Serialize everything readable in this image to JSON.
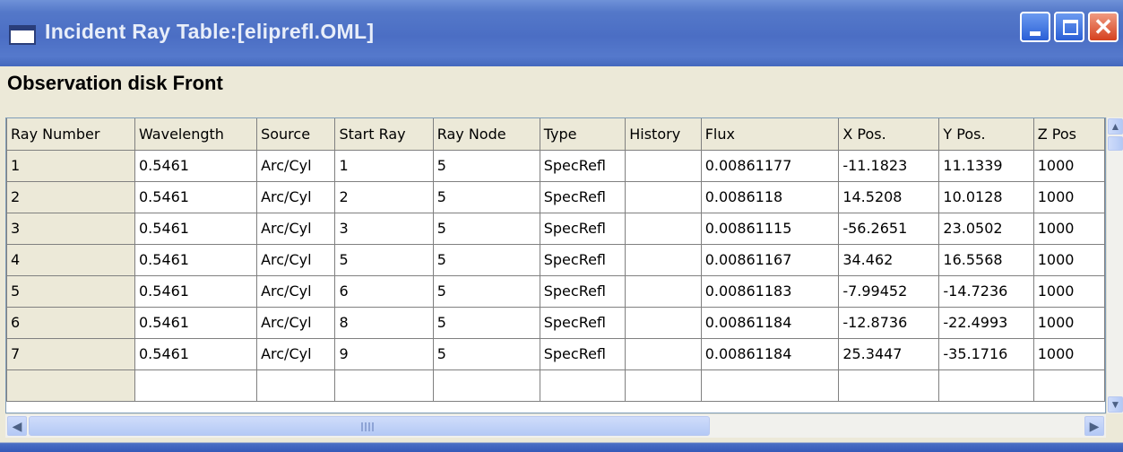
{
  "window": {
    "title": "Incident Ray Table:[eliprefl.OML]",
    "subtitle": "Observation disk Front",
    "controls": {
      "minimize": "minimize-icon",
      "maximize": "maximize-icon",
      "close": "close-icon"
    },
    "accent_color": "#4b6ec4"
  },
  "table": {
    "columns": [
      "Ray Number",
      "Wavelength",
      "Source",
      "Start Ray",
      "Ray Node",
      "Type",
      "History",
      "Flux",
      "X Pos.",
      "Y Pos.",
      "Z Pos"
    ],
    "rows": [
      [
        "1",
        "0.5461",
        "Arc/Cyl",
        "1",
        "5",
        "SpecRefl",
        "",
        "0.00861177",
        "-11.1823",
        "11.1339",
        "1000"
      ],
      [
        "2",
        "0.5461",
        "Arc/Cyl",
        "2",
        "5",
        "SpecRefl",
        "",
        "0.0086118",
        "14.5208",
        "10.0128",
        "1000"
      ],
      [
        "3",
        "0.5461",
        "Arc/Cyl",
        "3",
        "5",
        "SpecRefl",
        "",
        "0.00861115",
        "-56.2651",
        "23.0502",
        "1000"
      ],
      [
        "4",
        "0.5461",
        "Arc/Cyl",
        "5",
        "5",
        "SpecRefl",
        "",
        "0.00861167",
        "34.462",
        "16.5568",
        "1000"
      ],
      [
        "5",
        "0.5461",
        "Arc/Cyl",
        "6",
        "5",
        "SpecRefl",
        "",
        "0.00861183",
        "-7.99452",
        "-14.7236",
        "1000"
      ],
      [
        "6",
        "0.5461",
        "Arc/Cyl",
        "8",
        "5",
        "SpecRefl",
        "",
        "0.00861184",
        "-12.8736",
        "-22.4993",
        "1000"
      ],
      [
        "7",
        "0.5461",
        "Arc/Cyl",
        "9",
        "5",
        "SpecRefl",
        "",
        "0.00861184",
        "25.3447",
        "-35.1716",
        "1000"
      ]
    ]
  },
  "scrollbars": {
    "vertical": {
      "up_icon": "arrow-up-icon",
      "down_icon": "arrow-down-icon"
    },
    "horizontal": {
      "left_icon": "arrow-left-icon",
      "right_icon": "arrow-right-icon"
    }
  }
}
